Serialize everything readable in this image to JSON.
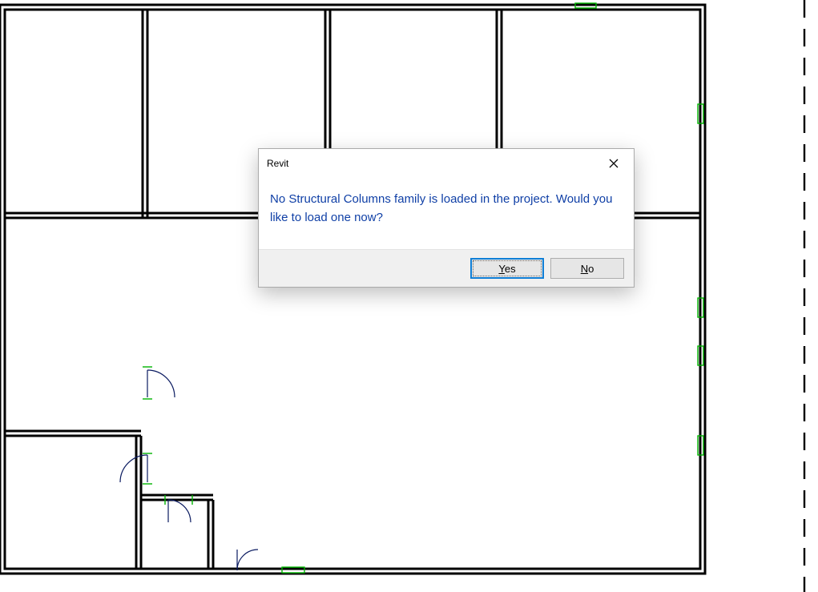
{
  "dialog": {
    "title": "Revit",
    "message": "No Structural Columns family is loaded in the project. Would you like to load one now?",
    "buttons": {
      "yes_prefix": "Y",
      "yes_rest": "es",
      "no_prefix": "N",
      "no_rest": "o"
    }
  }
}
